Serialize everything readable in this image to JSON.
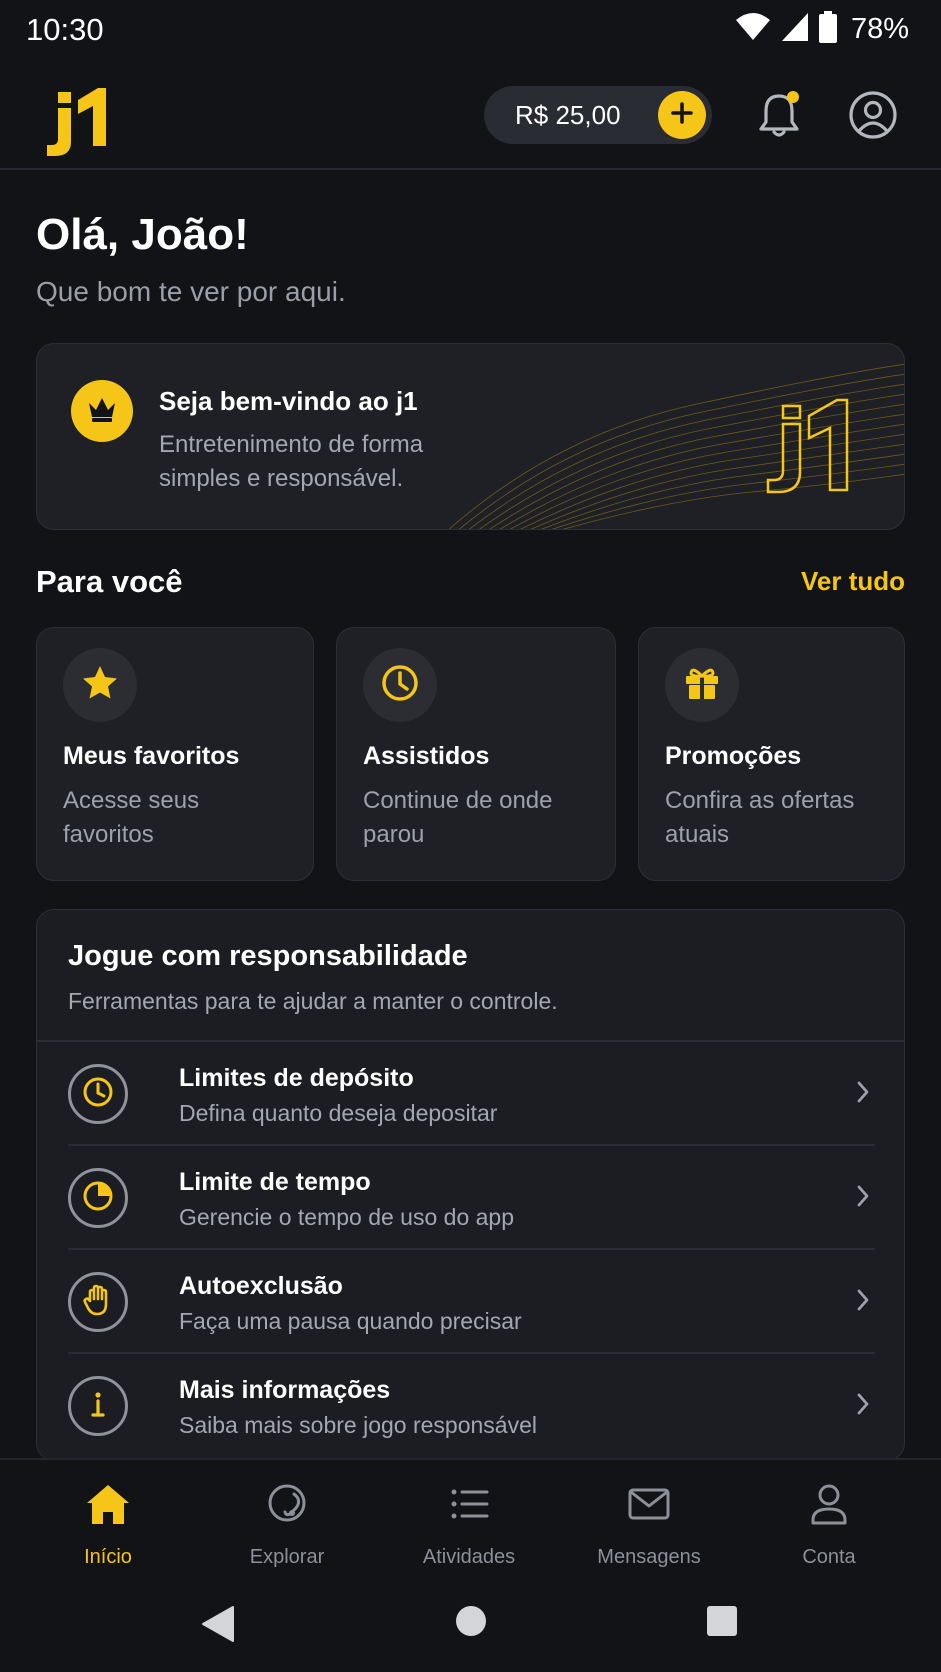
{
  "status_bar": {
    "time": "10:30",
    "battery": "78%"
  },
  "header": {
    "logo_text": "j1",
    "balance": "R$ 25,00",
    "add_funds_icon": "plus-icon",
    "notification_icon": "bell-icon",
    "has_notification_dot": true,
    "profile_icon": "user-circle-icon",
    "accent_color": "#f5c518"
  },
  "greeting": {
    "title": "Olá, João!",
    "subtitle": "Que bom te ver por aqui."
  },
  "welcome_banner": {
    "title": "Seja bem-vindo ao j1",
    "description": "Entretenimento de forma simples e responsável.",
    "logo_text": "j1",
    "icon": "crown-icon"
  },
  "for_you": {
    "title": "Para você",
    "see_all": "Ver tudo",
    "cards": [
      {
        "icon": "star-icon",
        "title": "Meus favoritos",
        "description": "Acesse seus favoritos"
      },
      {
        "icon": "clock-icon",
        "title": "Assistidos",
        "description": "Continue de onde parou"
      },
      {
        "icon": "gift-icon",
        "title": "Promoções",
        "description": "Confira as ofertas atuais"
      }
    ]
  },
  "responsible_gaming": {
    "title": "Jogue com responsabilidade",
    "subtitle": "Ferramentas para te ajudar a manter o controle.",
    "items": [
      {
        "icon": "deposit-clock-icon",
        "title": "Limites de depósito",
        "description": "Defina quanto deseja depositar"
      },
      {
        "icon": "timer-icon",
        "title": "Limite de tempo",
        "description": "Gerencie o tempo de uso do app"
      },
      {
        "icon": "hand-stop-icon",
        "title": "Autoexclusão",
        "description": "Faça uma pausa quando precisar"
      },
      {
        "icon": "info-icon",
        "title": "Mais informações",
        "description": "Saiba mais sobre jogo responsável"
      }
    ]
  },
  "bottom_nav": {
    "items": [
      {
        "label": "Início",
        "icon": "home-icon",
        "active": true
      },
      {
        "label": "Explorar",
        "icon": "explore-icon",
        "active": false
      },
      {
        "label": "Atividades",
        "icon": "list-icon",
        "active": false
      },
      {
        "label": "Mensagens",
        "icon": "mail-icon",
        "active": false
      },
      {
        "label": "Conta",
        "icon": "user-icon",
        "active": false
      }
    ]
  }
}
